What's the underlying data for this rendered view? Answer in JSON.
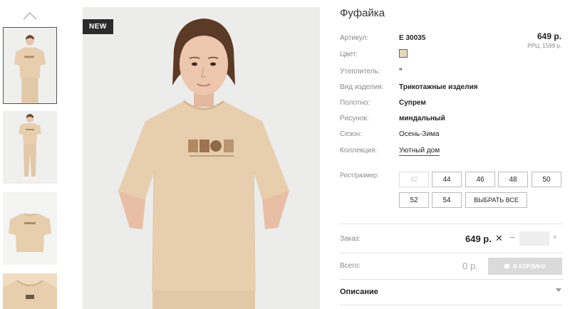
{
  "badge": "NEW",
  "product": {
    "title": "Фуфайка",
    "price": "649 р.",
    "rrc": "РРЦ: 1599 р."
  },
  "attributes": [
    {
      "label": "Артикул:",
      "value": "Е 30035"
    },
    {
      "label": "Цвет:",
      "value": ""
    },
    {
      "label": "Утеплитель:",
      "value": "\""
    },
    {
      "label": "Вид изделия:",
      "value": "Трикотажные изделия"
    },
    {
      "label": "Полотно:",
      "value": "Супрем"
    },
    {
      "label": "Рисунок:",
      "value": "миндальный"
    },
    {
      "label": "Сезон:",
      "value": "Осень-Зима"
    },
    {
      "label": "Коллекция:",
      "value": "Уютный дом"
    }
  ],
  "colors": {
    "swatch": "#e4d8bd",
    "accent": "#2b2b2b",
    "tshirt": "#e7cfae"
  },
  "sizes": {
    "label": "Рост/размер:",
    "options": [
      "42",
      "44",
      "46",
      "48",
      "50",
      "52",
      "54"
    ],
    "select_all": "ВЫБРАТЬ ВСЕ"
  },
  "order": {
    "label": "Заказ:",
    "price": "649 р.",
    "quantity": ""
  },
  "total": {
    "label": "Всего:",
    "price": "0 р.",
    "cart_button": "В КОРЗИНУ"
  },
  "description": {
    "title": "Описание"
  },
  "icons": [
    "chevron-up-icon",
    "close-icon",
    "minus-icon",
    "plus-icon",
    "cart-icon",
    "chevron-down-icon"
  ]
}
